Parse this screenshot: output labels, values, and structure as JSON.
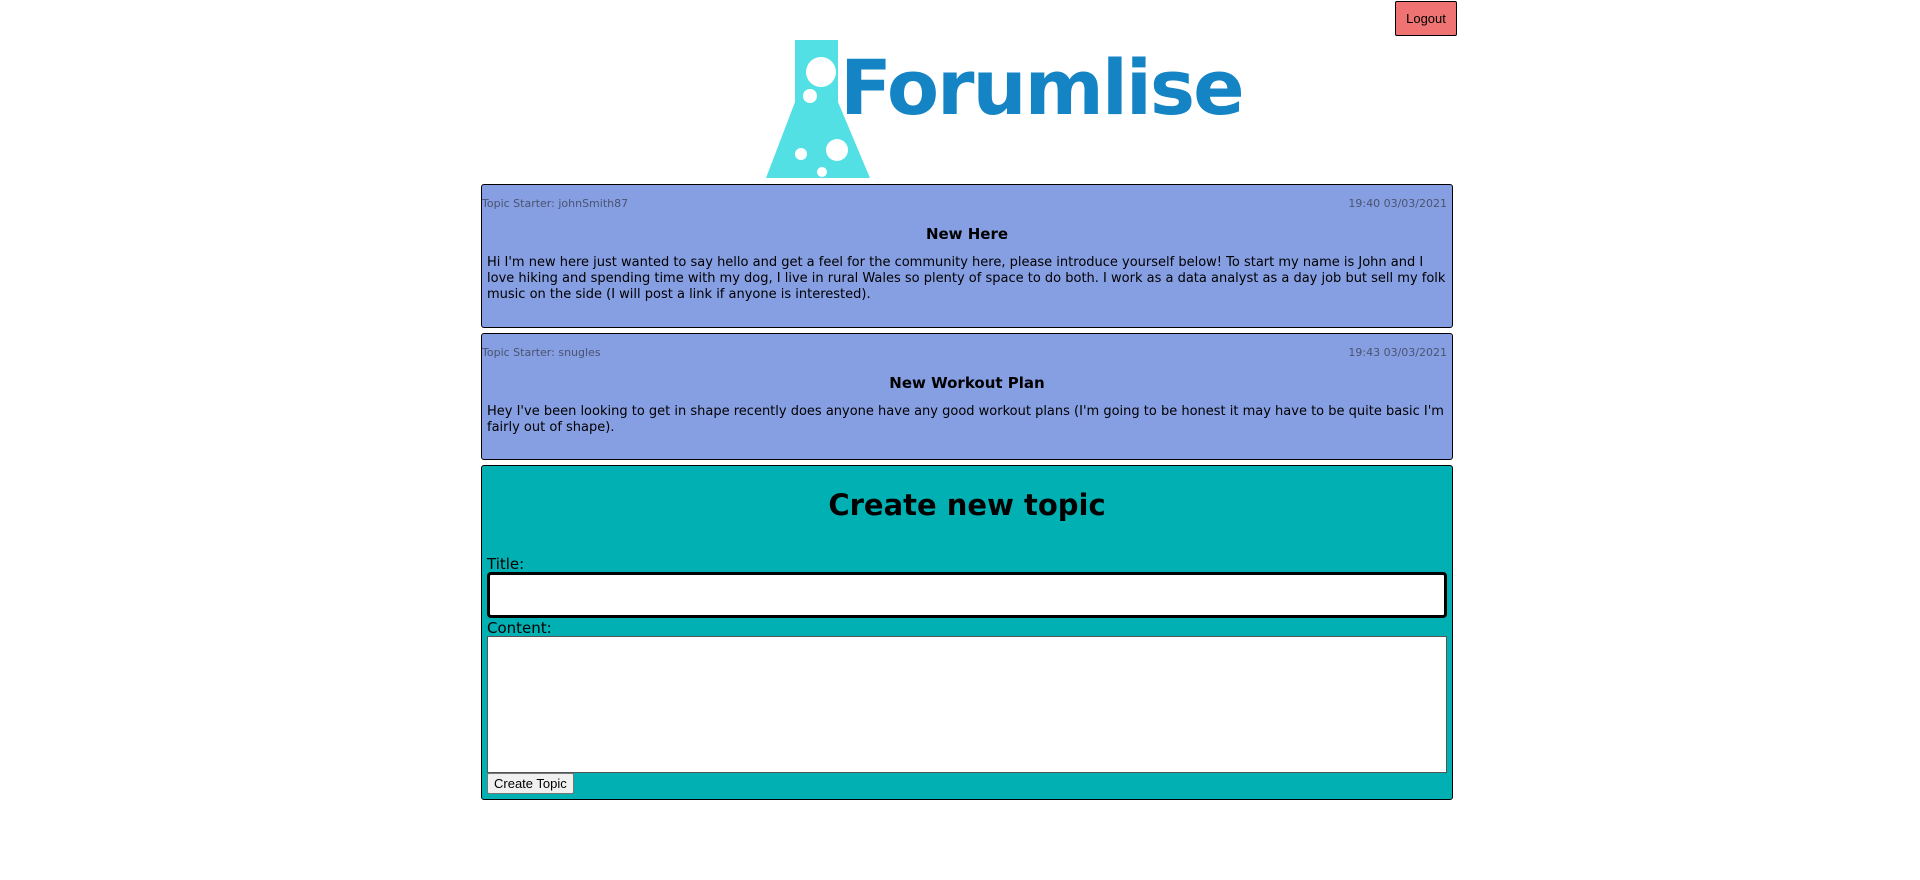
{
  "header": {
    "logout_label": "Logout",
    "logo_text": "Forumlise"
  },
  "topics": [
    {
      "starter": "Topic Starter: johnSmith87",
      "timestamp": "19:40 03/03/2021",
      "title": "New Here",
      "body": "Hi I'm new here just wanted to say hello and get a feel for the community here, please introduce yourself below! To start my name is John and I love hiking and spending time with my dog, I live in rural Wales so plenty of space to do both. I work as a data analyst as a day job but sell my folk music on the side (I will post a link if anyone is interested)."
    },
    {
      "starter": "Topic Starter: snugles",
      "timestamp": "19:43 03/03/2021",
      "title": "New Workout Plan",
      "body": "Hey I've been looking to get in shape recently does anyone have any good workout plans (I'm going to be honest it may have to be quite basic I'm fairly out of shape)."
    }
  ],
  "create_topic": {
    "heading": "Create new topic",
    "title_label": "Title:",
    "title_value": "",
    "content_label": "Content:",
    "content_value": "",
    "submit_label": "Create Topic"
  },
  "colors": {
    "logout_bg": "#f07373",
    "logo_text": "#1484c4",
    "logo_flask": "#52e0e4",
    "topic_bg": "#869ee2",
    "create_bg": "#00b0b2"
  },
  "icons": {
    "logo": "flask-icon"
  }
}
